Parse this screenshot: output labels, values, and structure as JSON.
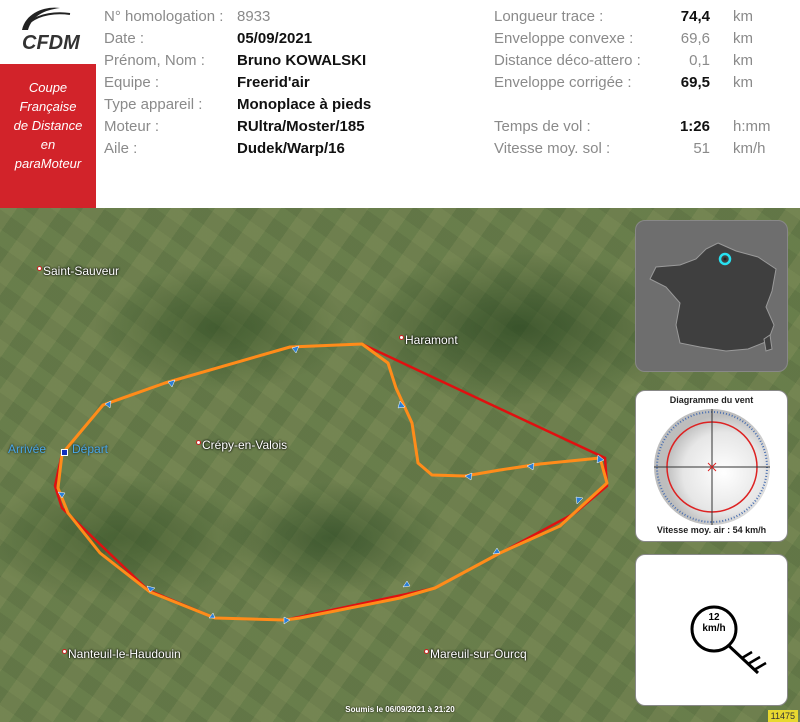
{
  "logo": {
    "text": "CFDM"
  },
  "cup": {
    "lines": [
      "Coupe",
      "Française",
      "de Distance",
      "en",
      "paraMoteur"
    ]
  },
  "info": {
    "homologation_label": "N° homologation :",
    "homologation_value": "8933",
    "date_label": "Date :",
    "date_value": "05/09/2021",
    "name_label": "Prénom, Nom :",
    "name_value": "Bruno KOWALSKI",
    "team_label": "Equipe :",
    "team_value": "Freerid'air",
    "aircraft_label": "Type appareil :",
    "aircraft_value": "Monoplace à pieds",
    "engine_label": "Moteur :",
    "engine_value": "RUltra/Moster/185",
    "wing_label": "Aile :",
    "wing_value": "Dudek/Warp/16"
  },
  "stats": {
    "track_length_label": "Longueur trace :",
    "track_length_value": "74,4",
    "track_length_unit": "km",
    "convex_label": "Enveloppe convexe :",
    "convex_value": "69,6",
    "convex_unit": "km",
    "takeoff_landing_label": "Distance déco-attero :",
    "takeoff_landing_value": "0,1",
    "takeoff_landing_unit": "km",
    "corrected_label": "Enveloppe corrigée :",
    "corrected_value": "69,5",
    "corrected_unit": "km",
    "flight_time_label": "Temps de vol :",
    "flight_time_value": "1:26",
    "flight_time_unit": "h:mm",
    "ground_speed_label": "Vitesse moy. sol :",
    "ground_speed_value": "51",
    "ground_speed_unit": "km/h"
  },
  "map": {
    "towns": {
      "saint_sauveur": "Saint-Sauveur",
      "haramont": "Haramont",
      "crepy": "Crépy-en-Valois",
      "nanteuil": "Nanteuil-le-Haudouin",
      "mareuil": "Mareuil-sur-Ourcq"
    },
    "arrivee": "Arrivée",
    "depart": "Départ",
    "footer": "Soumis le 06/09/2021 à 21:20",
    "id_badge": "11475"
  },
  "wind": {
    "title": "Diagramme du vent",
    "air_speed": "Vitesse moy. air : 54 km/h",
    "speed_label": "12 km/h"
  },
  "colors": {
    "brand_red": "#d2232a",
    "track_orange": "#ff8c1a",
    "envelope_red": "#e01010",
    "marker_blue": "#1030c0"
  }
}
